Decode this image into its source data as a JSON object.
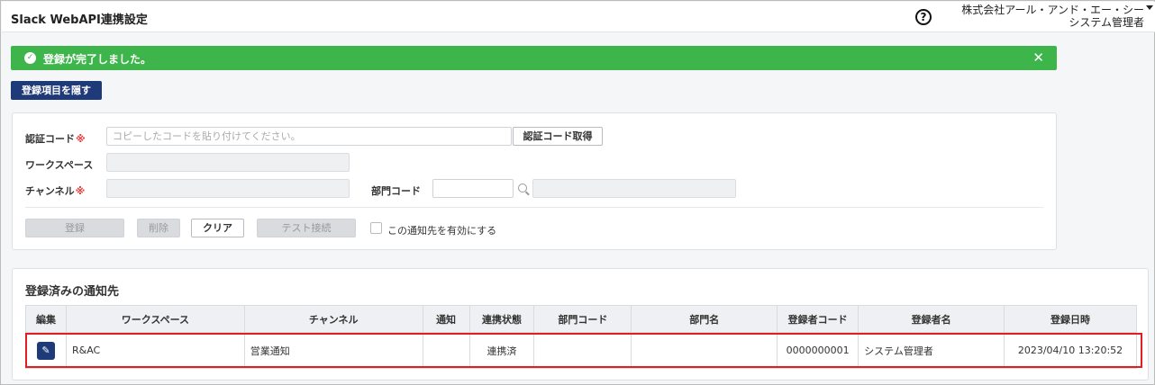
{
  "header": {
    "title": "Slack WebAPI連携設定",
    "help_icon": "?",
    "company": "株式会社アール・アンド・エー・シー",
    "user_role": "システム管理者"
  },
  "alert": {
    "message": "登録が完了しました。",
    "close": "✕",
    "color": "#3db54a"
  },
  "toggle_button": "登録項目を隠す",
  "form": {
    "auth_code_label": "認証コード",
    "required_mark": "※",
    "auth_code_placeholder": "コピーしたコードを貼り付けてください。",
    "get_auth_code_button": "認証コード取得",
    "workspace_label": "ワークスペース",
    "channel_label": "チャンネル",
    "dept_code_label": "部門コード",
    "register_button": "登録",
    "delete_button": "削除",
    "clear_button": "クリア",
    "test_button": "テスト接続",
    "enable_label": "この通知先を有効にする"
  },
  "registered": {
    "title": "登録済みの通知先",
    "columns": [
      "編集",
      "ワークスペース",
      "チャンネル",
      "通知",
      "連携状態",
      "部門コード",
      "部門名",
      "登録者コード",
      "登録者名",
      "登録日時"
    ],
    "rows": [
      {
        "workspace": "R&AC",
        "channel": "営業通知",
        "notify": "",
        "status": "連携済",
        "dept_code": "",
        "dept_name": "",
        "registrant_code": "0000000001",
        "registrant_name": "システム管理者",
        "registered_at": "2023/04/10 13:20:52"
      }
    ]
  },
  "colors": {
    "primary": "#1f3a78",
    "success": "#3db54a",
    "highlight": "#e02020"
  }
}
